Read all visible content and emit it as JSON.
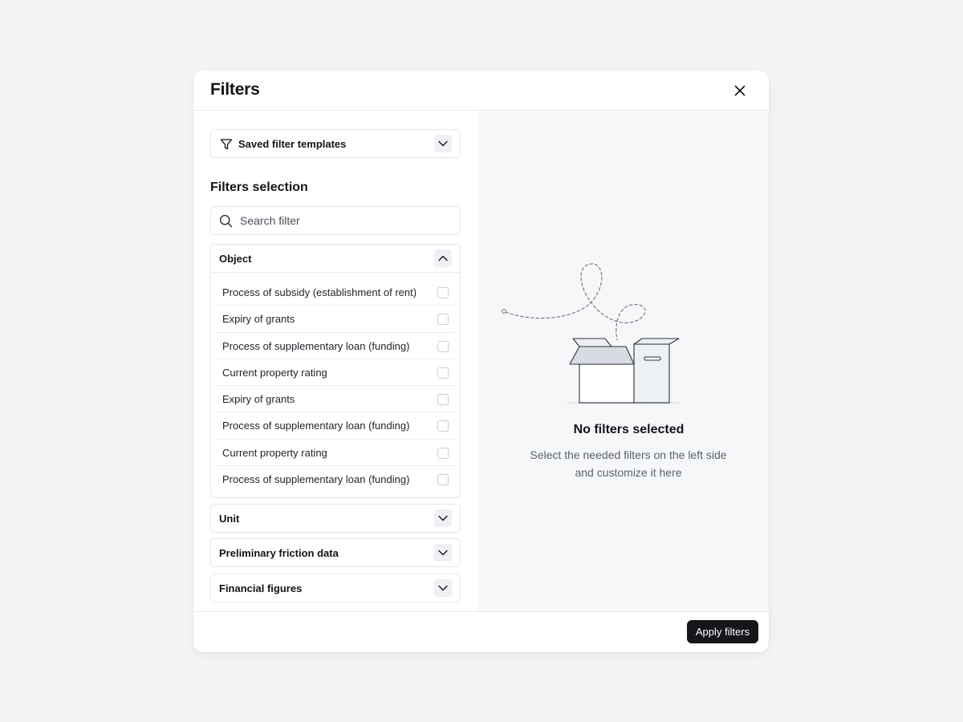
{
  "modal": {
    "title": "Filters"
  },
  "templates": {
    "label": "Saved filter templates"
  },
  "selection": {
    "heading": "Filters selection",
    "search_placeholder": "Search filter"
  },
  "groups": {
    "object": {
      "title": "Object",
      "expanded": true,
      "items": [
        "Process of subsidy (establishment of rent)",
        "Expiry of grants",
        "Process of supplementary loan (funding)",
        "Current property rating",
        "Expiry of grants",
        "Process of supplementary loan (funding)",
        "Current property rating",
        "Process of supplementary loan (funding)"
      ]
    },
    "unit": {
      "title": "Unit",
      "expanded": false
    },
    "friction": {
      "title": "Preliminary friction data",
      "expanded": false
    },
    "financial": {
      "title": "Financial figures",
      "expanded": false
    }
  },
  "empty_state": {
    "title": "No filters selected",
    "text": "Select the needed filters on the left side and customize it here"
  },
  "footer": {
    "apply_label": "Apply filters"
  },
  "icons": {
    "close": "close-icon",
    "filter": "filter-funnel-icon",
    "search": "search-icon",
    "chevron_down": "chevron-down-icon",
    "chevron_up": "chevron-up-icon",
    "empty_box": "empty-box-illustration"
  },
  "colors": {
    "page_background": "#f2f3f5",
    "modal_background": "#ffffff",
    "right_pane_background": "#f6f7f9",
    "primary_button": "#14161a",
    "border": "#e3e6ea",
    "text_primary": "#111418",
    "text_secondary": "#5a616b"
  }
}
